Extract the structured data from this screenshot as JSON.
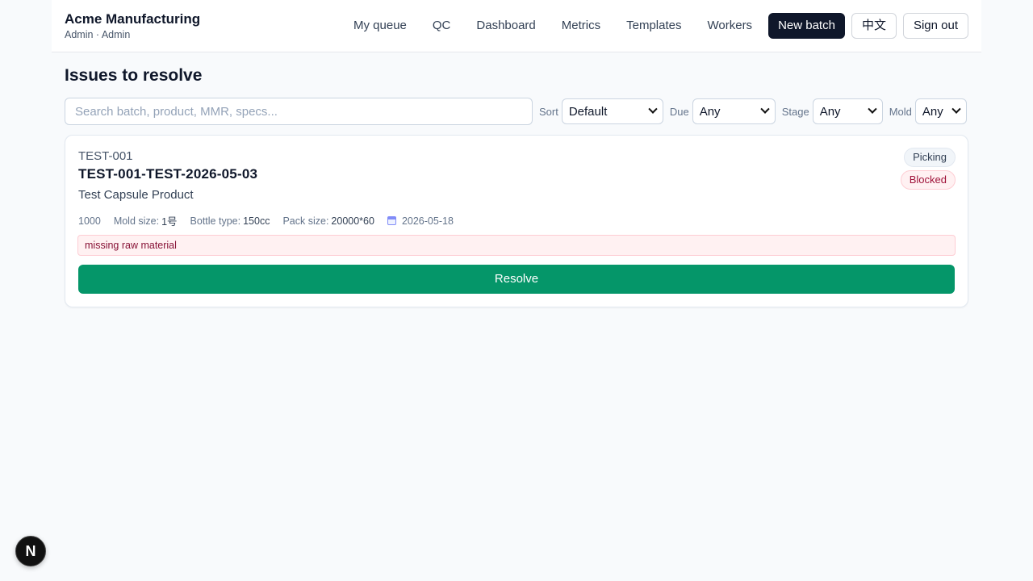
{
  "header": {
    "title": "Acme Manufacturing",
    "subtitle": "Admin · Admin",
    "nav": [
      "My queue",
      "QC",
      "Dashboard",
      "Metrics",
      "Templates",
      "Workers"
    ],
    "new_batch": "New batch",
    "language": "中文",
    "sign_out": "Sign out"
  },
  "page": {
    "title": "Issues to resolve"
  },
  "filters": {
    "search_placeholder": "Search batch, product, MMR, specs...",
    "sort_label": "Sort",
    "sort_value": "Default",
    "due_label": "Due",
    "due_value": "Any",
    "stage_label": "Stage",
    "stage_value": "Any",
    "mold_label": "Mold",
    "mold_value": "Any"
  },
  "card": {
    "code": "TEST-001",
    "name": "TEST-001-TEST-2026-05-03",
    "product": "Test Capsule Product",
    "quantity": "1000",
    "mold_label": "Mold size:",
    "mold_value": "1号",
    "bottle_label": "Bottle type:",
    "bottle_value": "150cc",
    "pack_label": "Pack size:",
    "pack_value": "20000*60",
    "date": "2026-05-18",
    "stage_badge": "Picking",
    "status_badge": "Blocked",
    "issue": "missing raw material",
    "resolve": "Resolve"
  },
  "dev_badge": {
    "letter": "N"
  }
}
